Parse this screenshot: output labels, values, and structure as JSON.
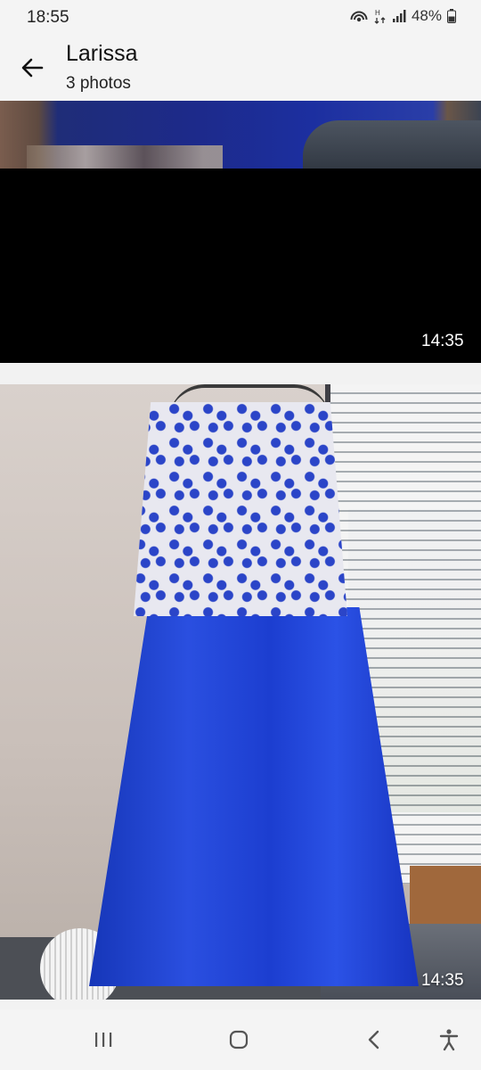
{
  "status_bar": {
    "time": "18:55",
    "battery": "48%"
  },
  "header": {
    "title": "Larissa",
    "subtitle": "3 photos"
  },
  "photos": [
    {
      "timestamp": "14:35"
    },
    {
      "timestamp": "14:35"
    }
  ],
  "navigation": {
    "recents_icon": "recents-icon",
    "home_icon": "home-icon",
    "back_icon": "back-chevron-icon",
    "accessibility_icon": "accessibility-icon"
  }
}
